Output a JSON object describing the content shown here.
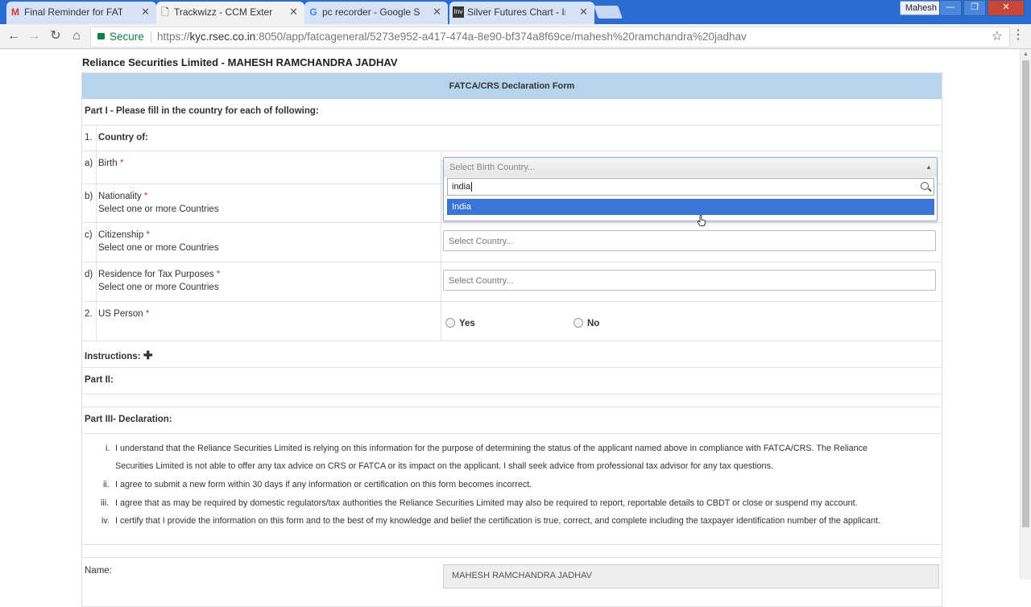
{
  "browser": {
    "tabs": [
      {
        "label": "Final Reminder for FATC",
        "icon": "gmail-icon"
      },
      {
        "label": "Trackwizz - CCM External",
        "icon": "page-icon"
      },
      {
        "label": "pc recorder - Google Sea",
        "icon": "google-icon"
      },
      {
        "label": "Silver Futures Chart - Inv",
        "icon": "investing-icon"
      }
    ],
    "user": "Mahesh",
    "secure_label": "Secure",
    "url_scheme": "https://",
    "url_host": "kyc.rsec.co.in",
    "url_rest": ":8050/app/fatcageneral/5273e952-a417-474a-8e90-bf374a8f69ce/mahesh%20ramchandra%20jadhav"
  },
  "page": {
    "title": "Reliance Securities Limited - MAHESH RAMCHANDRA JADHAV",
    "form_title": "FATCA/CRS Declaration Form",
    "part1": "Part I - Please fill in the country for each of following:",
    "q1_num": "1.",
    "q1_label": "Country of:",
    "birth": {
      "letter": "a)",
      "label": "Birth",
      "req": "*",
      "placeholder": "Select Birth Country..."
    },
    "nationality": {
      "letter": "b)",
      "label": "Nationality",
      "req": "*",
      "hint": "Select one or more Countries"
    },
    "citizenship": {
      "letter": "c)",
      "label": "Citizenship",
      "req": "*",
      "hint": "Select one or more Countries",
      "placeholder": "Select Country..."
    },
    "residence": {
      "letter": "d)",
      "label": "Residence for Tax Purposes",
      "req": "*",
      "hint": "Select one or more Countries",
      "placeholder": "Select Country..."
    },
    "us_person": {
      "num": "2.",
      "label": "US Person",
      "req": "*",
      "yes": "Yes",
      "no": "No"
    },
    "instructions": "Instructions:",
    "part2": "Part II:",
    "part3": "Part III- Declaration:",
    "declarations": [
      {
        "num": "i.",
        "lines": [
          "I understand that the Reliance Securities Limited is relying on this information for the purpose of determining the status of the applicant named above in compliance with FATCA/CRS. The Reliance",
          "Securities Limited is not able to offer any tax advice on CRS or FATCA or its impact on the applicant. I shall seek advice from professional tax advisor for any tax questions."
        ]
      },
      {
        "num": "ii.",
        "lines": [
          "I agree to submit a new form within 30 days if any information or certification on this form becomes incorrect."
        ]
      },
      {
        "num": "iii.",
        "lines": [
          "I agree that as may be required by domestic regulators/tax authorities the Reliance Securities Limited may also be required to report, reportable details to CBDT or close or suspend my account."
        ]
      },
      {
        "num": "iv.",
        "lines": [
          "I certify that I provide the information on this form and to the best of my knowledge and belief the certification is true, correct, and complete including the taxpayer identification number of the applicant."
        ]
      }
    ],
    "name_label": "Name:",
    "name_value": "MAHESH RAMCHANDRA JADHAV"
  },
  "dropdown": {
    "search_value": "india",
    "option": "India"
  },
  "colors": {
    "header_blue": "#b8d3ec",
    "highlight": "#3875d7",
    "tabstrip": "#2a6ccf"
  }
}
